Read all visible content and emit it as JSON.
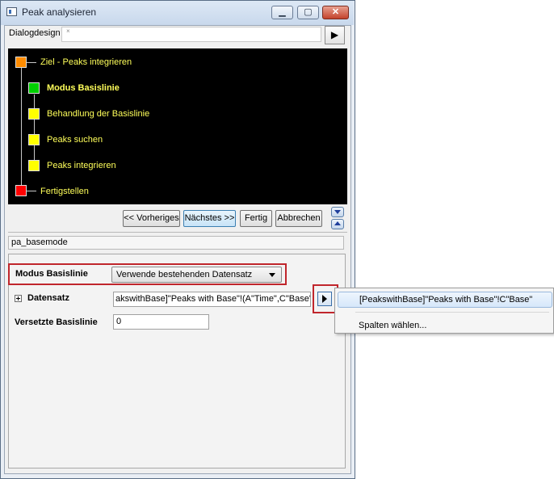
{
  "window": {
    "title": "Peak analysieren",
    "controls": {
      "minimize": "▁",
      "maximize": "▢",
      "close": "✕"
    }
  },
  "dialog": {
    "label": "Dialogdesign",
    "field_value": "×",
    "arrow": "▶"
  },
  "steps": [
    {
      "label": "Ziel - Peaks integrieren",
      "color": "#ff8c00",
      "current": false
    },
    {
      "label": "Modus Basislinie",
      "color": "#00d000",
      "current": true
    },
    {
      "label": "Behandlung der Basislinie",
      "color": "#ffff00",
      "current": false
    },
    {
      "label": "Peaks suchen",
      "color": "#ffff00",
      "current": false
    },
    {
      "label": "Peaks integrieren",
      "color": "#ffff00",
      "current": false
    },
    {
      "label": "Fertigstellen",
      "color": "#ff0000",
      "current": false
    }
  ],
  "nav": {
    "previous": "<< Vorheriges",
    "next": "Nächstes >>",
    "finish": "Fertig",
    "cancel": "Abbrechen"
  },
  "theme_name": "pa_basemode",
  "settings": {
    "mode_label": "Modus Basislinie",
    "mode_value": "Verwende bestehenden Datensatz",
    "dataset_label": "Datensatz",
    "dataset_value": "akswithBase]\"Peaks with Base\"!(A\"Time\",C\"Base\"",
    "offset_label": "Versetzte Basislinie",
    "offset_value": "0"
  },
  "popup_menu": {
    "items": [
      "[PeakswithBase]\"Peaks with Base\"!C\"Base\"",
      "Spalten wählen..."
    ]
  },
  "colors": {
    "highlight_red": "#c0262c",
    "tree_background": "#000000",
    "step_text": "#ffff5a"
  }
}
